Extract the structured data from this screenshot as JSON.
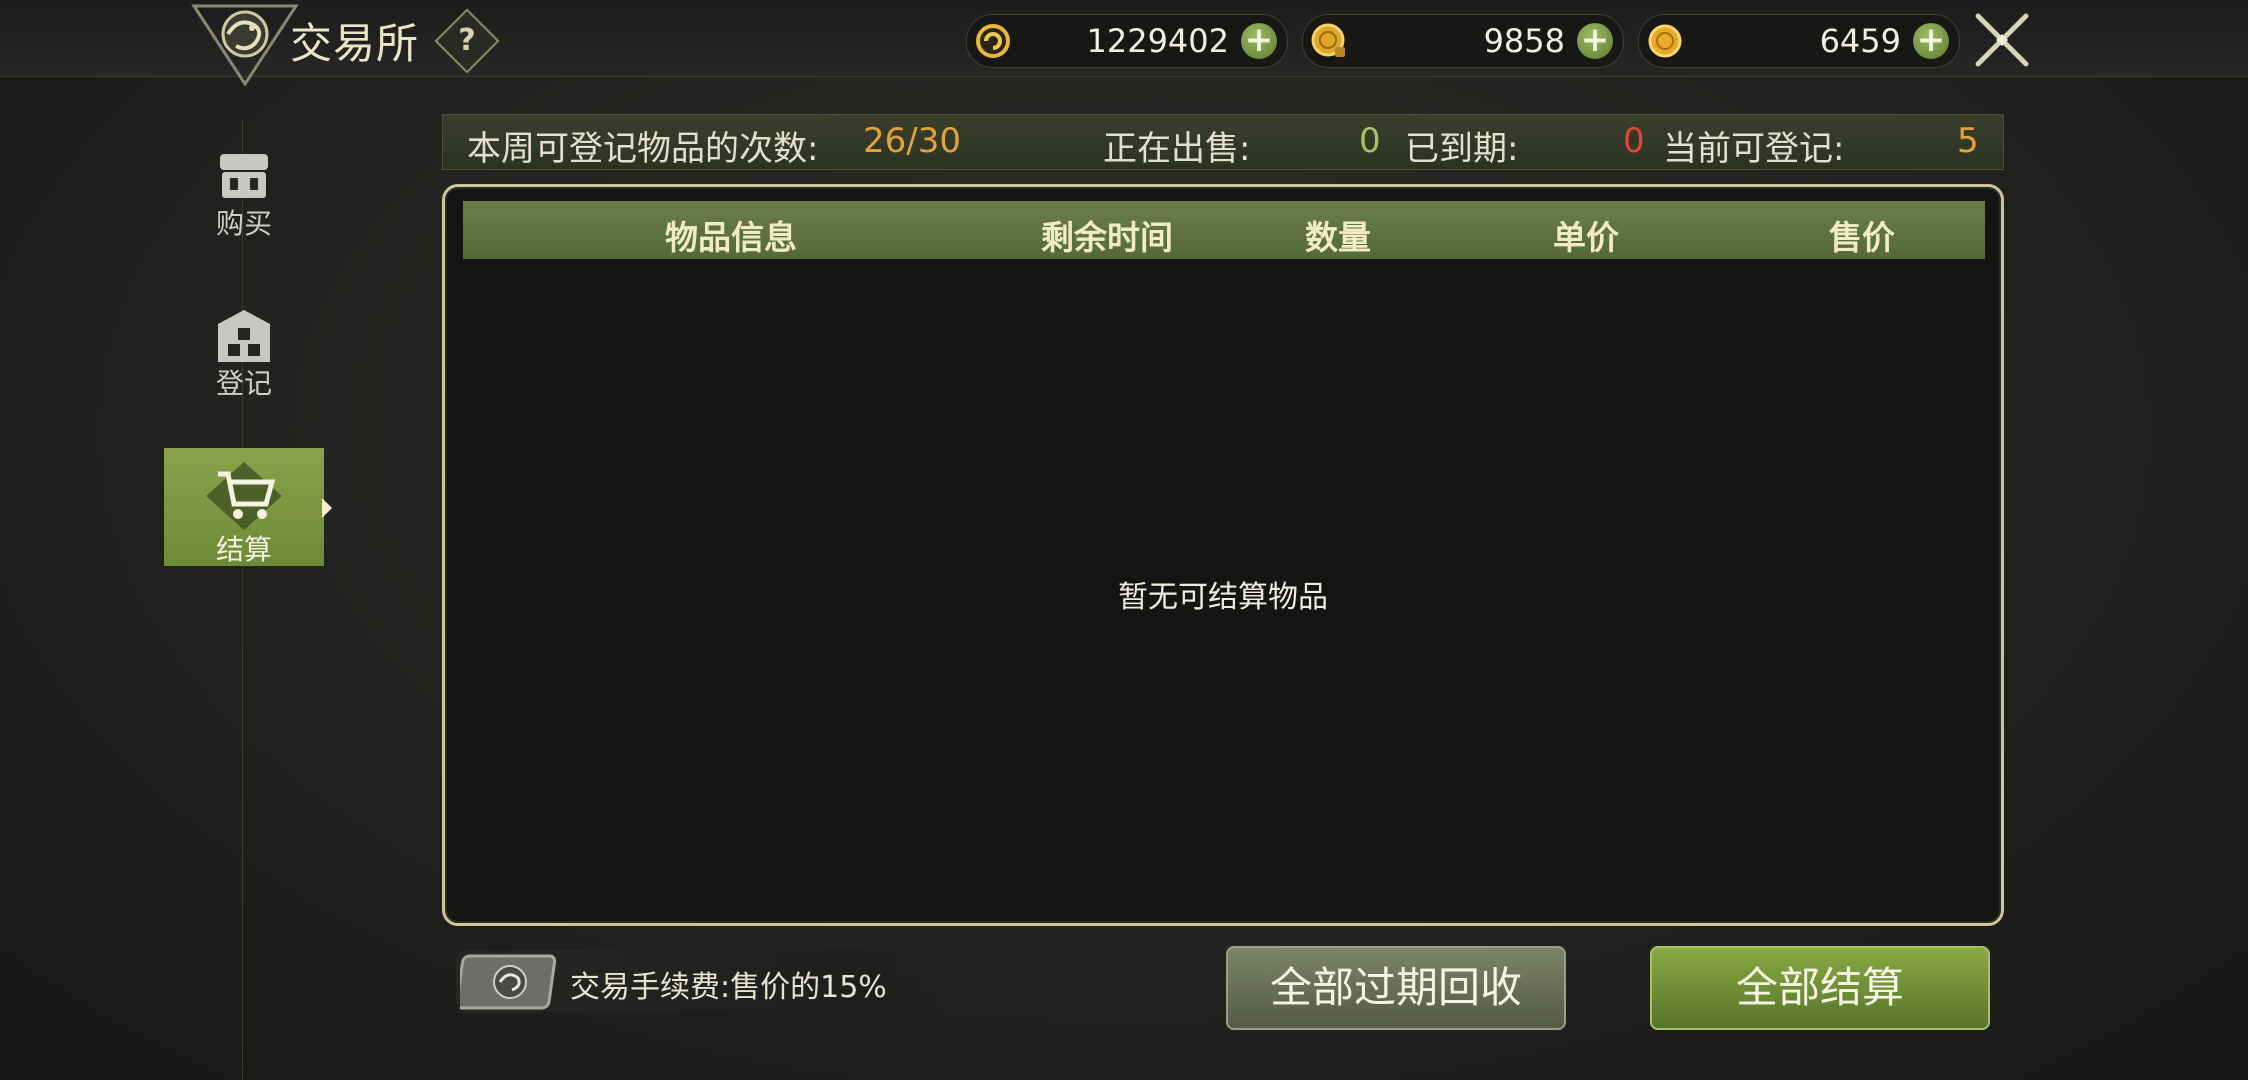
{
  "header": {
    "title": "交易所",
    "help_icon": "question-icon"
  },
  "currencies": [
    {
      "icon": "refresh-coin-icon",
      "value": "1229402"
    },
    {
      "icon": "bound-gold-coin-icon",
      "value": "9858"
    },
    {
      "icon": "gold-coin-icon",
      "value": "6459"
    }
  ],
  "sidebar": {
    "items": [
      {
        "label": "购买",
        "icon": "shop-icon"
      },
      {
        "label": "登记",
        "icon": "register-icon"
      },
      {
        "label": "结算",
        "icon": "cart-icon",
        "active": true
      }
    ]
  },
  "info": {
    "weekly_label": "本周可登记物品的次数:",
    "weekly_value": "26/30",
    "selling_label": "正在出售:",
    "selling_value": "0",
    "expired_label": "已到期:",
    "expired_value": "0",
    "available_label": "当前可登记:",
    "available_value": "5"
  },
  "table": {
    "headers": [
      "物品信息",
      "剩余时间",
      "数量",
      "单价",
      "售价"
    ],
    "empty_text": "暂无可结算物品"
  },
  "footer": {
    "fee_text": "交易手续费:售价的15%",
    "recycle_button": "全部过期回收",
    "settle_button": "全部结算"
  },
  "colors": {
    "accent_green": "#7b9a3c",
    "orange_value": "#e0a23a",
    "green_value": "#a8c060",
    "red_value": "#e0463a"
  }
}
